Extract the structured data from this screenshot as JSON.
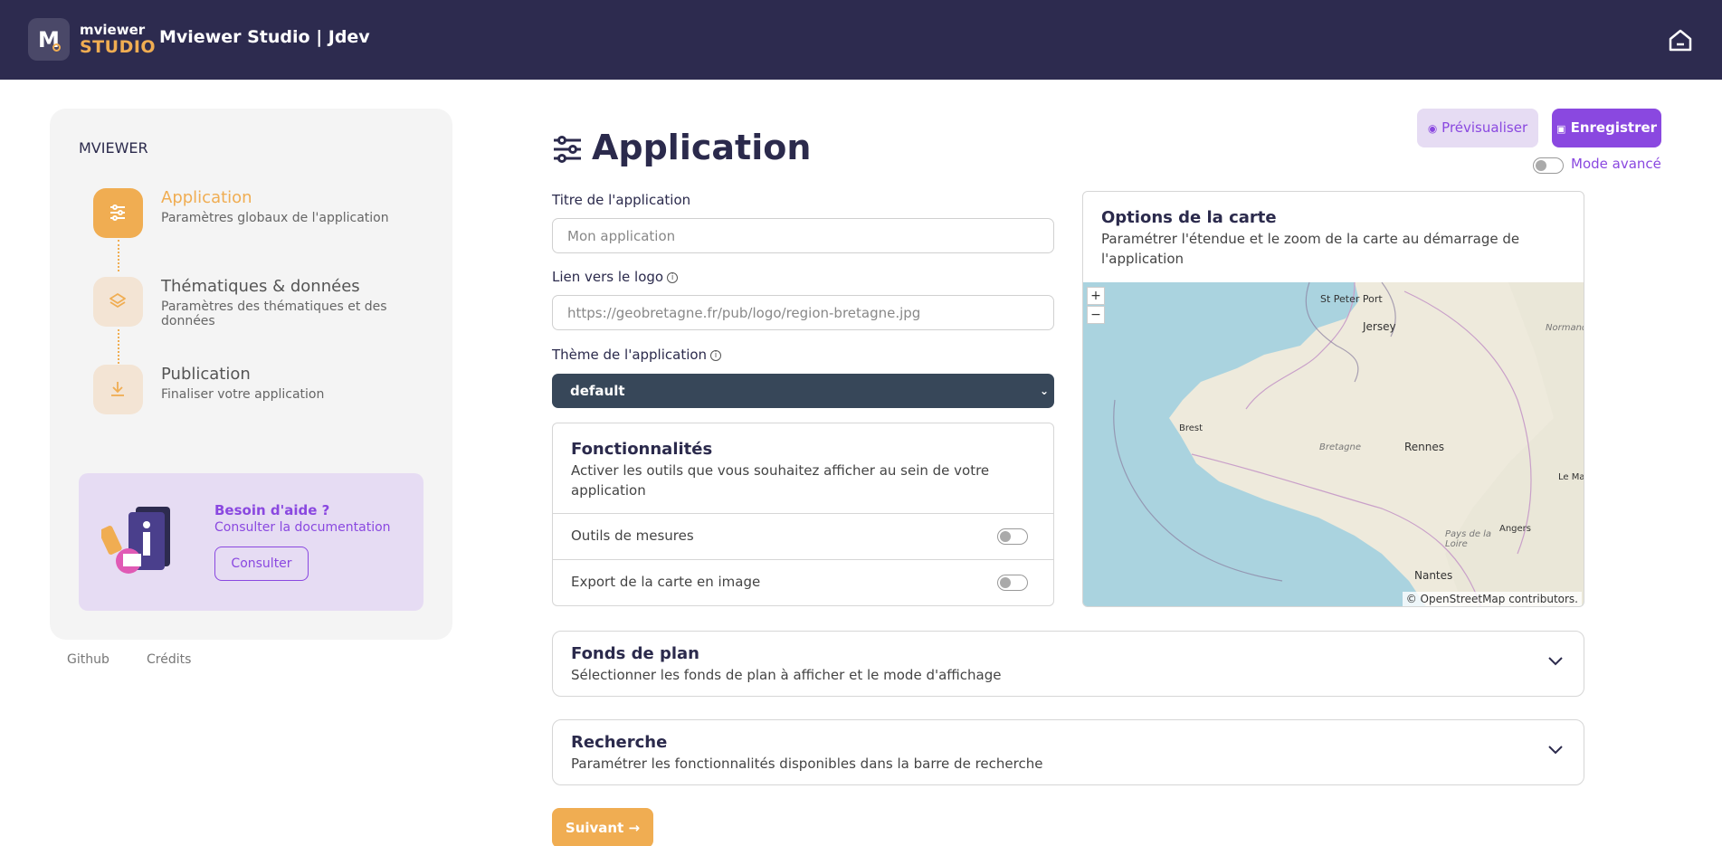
{
  "header": {
    "logo_line1": "mviewer",
    "logo_line2": "STUDIO",
    "title": "Mviewer Studio | Jdev",
    "home_icon": "home-icon"
  },
  "sidebar": {
    "heading": "MVIEWER",
    "steps": [
      {
        "title": "Application",
        "subtitle": "Paramètres globaux de l'application",
        "icon": "sliders-icon",
        "active": true
      },
      {
        "title": "Thématiques & données",
        "subtitle": "Paramètres des thématiques et des données",
        "icon": "layers-icon",
        "active": false
      },
      {
        "title": "Publication",
        "subtitle": "Finaliser votre application",
        "icon": "download-icon",
        "active": false
      }
    ],
    "help": {
      "title": "Besoin d'aide ?",
      "subtitle": "Consulter la documentation",
      "button": "Consulter"
    },
    "footer_links": [
      "Github",
      "Crédits"
    ]
  },
  "main": {
    "title": "Application",
    "preview_button": "Prévisualiser",
    "save_button": "Enregistrer",
    "advanced_mode_label": "Mode avancé",
    "fields": {
      "app_title_label": "Titre de l'application",
      "app_title_placeholder": "Mon application",
      "logo_label": "Lien vers le logo",
      "logo_placeholder": "https://geobretagne.fr/pub/logo/region-bretagne.jpg",
      "theme_label": "Thème de l'application",
      "theme_value": "default"
    },
    "features": {
      "title": "Fonctionnalités",
      "subtitle": "Activer les outils que vous souhaitez afficher au sein de votre application",
      "rows": [
        {
          "label": "Outils de mesures",
          "enabled": false
        },
        {
          "label": "Export de la carte en image",
          "enabled": false
        }
      ]
    },
    "map_options": {
      "title": "Options de la carte",
      "subtitle": "Paramétrer l'étendue et le zoom de la carte au démarrage de l'application",
      "zoom_in": "+",
      "zoom_out": "−",
      "attribution": "© OpenStreetMap contributors.",
      "places": [
        "St Peter Port",
        "Jersey",
        "Normandi",
        "Brest",
        "Bretagne",
        "Rennes",
        "Le Ma",
        "Pays de la Loire",
        "Angers",
        "Nantes"
      ]
    },
    "accordions": [
      {
        "title": "Fonds de plan",
        "subtitle": "Sélectionner les fonds de plan à afficher et le mode d'affichage"
      },
      {
        "title": "Recherche",
        "subtitle": "Paramétrer les fonctionnalités disponibles dans la barre de recherche"
      }
    ],
    "next_button": "Suivant",
    "colors": {
      "accent": "#8a48e0",
      "orange": "#f0ad52",
      "navy": "#2d2b4f"
    }
  }
}
